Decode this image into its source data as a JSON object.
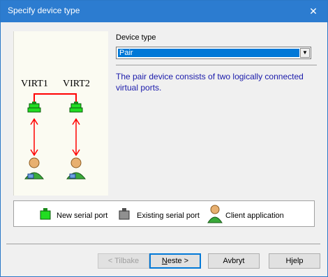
{
  "window": {
    "title": "Specify device type",
    "close_glyph": "✕"
  },
  "diagram": {
    "port_labels": [
      "VIRT1",
      "VIRT2"
    ],
    "link_color": "#ff0000",
    "new_port_color": "#22dd22"
  },
  "device_type": {
    "label": "Device type",
    "selected": "Pair"
  },
  "description": "The pair device consists of two logically connected virtual ports.",
  "legend": {
    "new_port": {
      "label": "New serial port",
      "icon": "new-serial-port-icon"
    },
    "existing_port": {
      "label": "Existing serial port",
      "icon": "existing-serial-port-icon"
    },
    "client_app": {
      "label": "Client application",
      "icon": "client-application-icon"
    }
  },
  "buttons": {
    "back": "< Tilbake",
    "next_prefix": "N",
    "next_rest": "este >",
    "cancel": "Avbryt",
    "help": "Hjelp"
  }
}
